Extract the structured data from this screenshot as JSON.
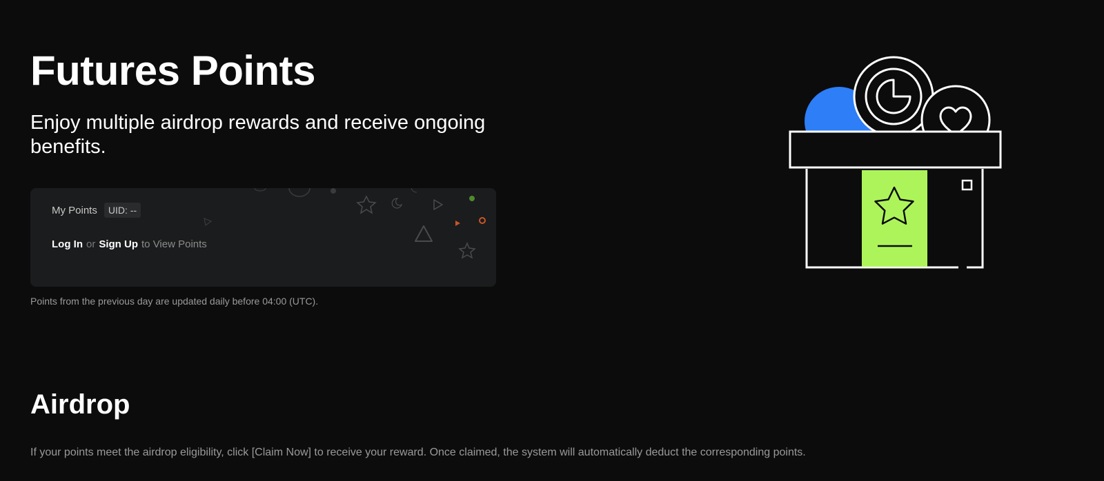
{
  "header": {
    "title": "Futures Points",
    "subtitle": "Enjoy multiple airdrop rewards and receive ongoing benefits."
  },
  "points_card": {
    "label": "My Points",
    "uid_label": "UID:",
    "uid_value": "--",
    "login_label": "Log In",
    "or_text": "or",
    "signup_label": "Sign Up",
    "suffix_text": "to View Points"
  },
  "update_note": "Points from the previous day are updated daily before 04:00 (UTC).",
  "airdrop": {
    "title": "Airdrop",
    "description": "If your points meet the airdrop eligibility, click [Claim Now] to receive your reward. Once claimed, the system will automatically deduct the corresponding points."
  },
  "icons": {
    "gift": "gift-box-illustration",
    "star": "star-icon",
    "heart_coin": "heart-coin-icon",
    "logo_coin": "logo-coin-icon"
  },
  "colors": {
    "background": "#0c0c0c",
    "card": "#1b1c1d",
    "accent_green": "#adf45a",
    "accent_blue": "#2d7ef7"
  }
}
